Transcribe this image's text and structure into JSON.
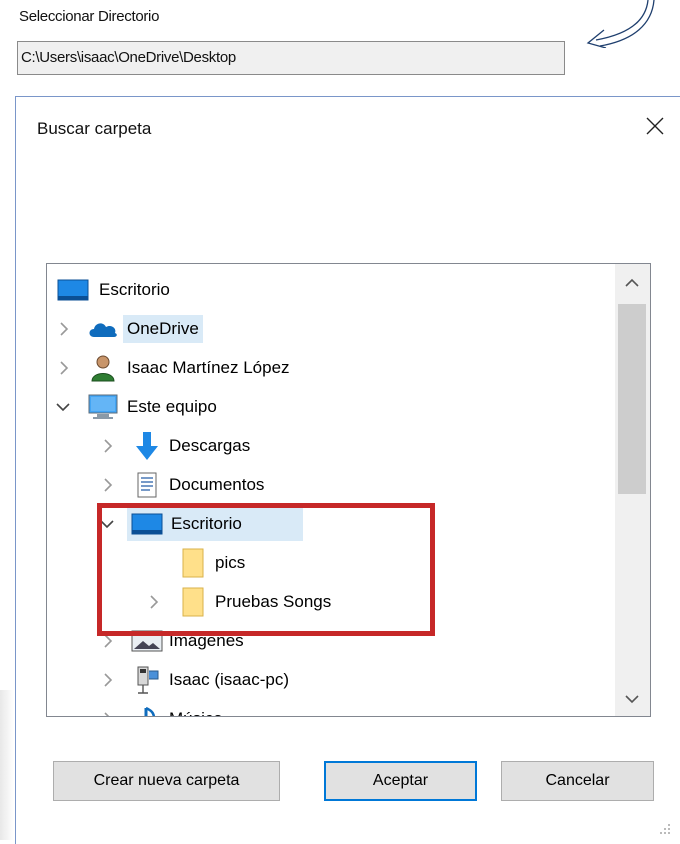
{
  "window": {
    "select_dir_label": "Seleccionar Directorio",
    "path_value": "C:\\Users\\isaac\\OneDrive\\Desktop"
  },
  "dialog": {
    "title": "Buscar carpeta",
    "tree": [
      {
        "label": "Escritorio",
        "icon": "desktop-icon"
      },
      {
        "label": "OneDrive",
        "icon": "cloud-icon"
      },
      {
        "label": "Isaac Martínez López",
        "icon": "user-icon"
      },
      {
        "label": "Este equipo",
        "icon": "computer-icon"
      },
      {
        "label": "Descargas",
        "icon": "download-arrow-icon"
      },
      {
        "label": "Documentos",
        "icon": "document-icon"
      },
      {
        "label": "Escritorio",
        "icon": "desktop-icon"
      },
      {
        "label": "pics",
        "icon": "folder-icon"
      },
      {
        "label": "Pruebas Songs",
        "icon": "folder-icon"
      },
      {
        "label": "Imágenes",
        "icon": "pictures-icon"
      },
      {
        "label": "Isaac (isaac-pc)",
        "icon": "network-drive-icon"
      },
      {
        "label": "Música",
        "icon": "music-note-icon"
      }
    ],
    "buttons": {
      "new_folder": "Crear nueva carpeta",
      "accept": "Aceptar",
      "cancel": "Cancelar"
    }
  },
  "colors": {
    "selection": "#d9eaf7",
    "highlight_box": "#c62828",
    "primary_border": "#0078d7"
  }
}
